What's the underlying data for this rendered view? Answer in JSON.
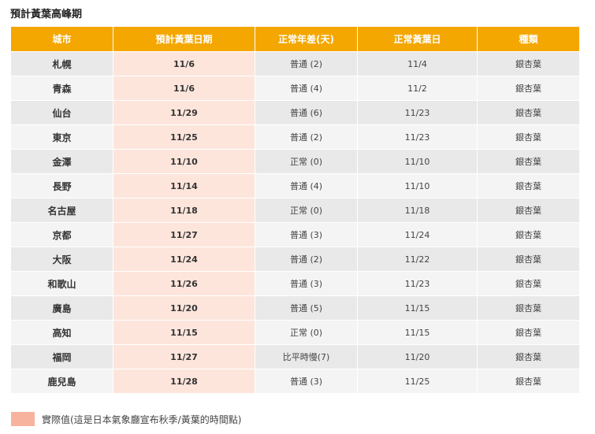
{
  "title": "預計黃葉高峰期",
  "headers": [
    "城市",
    "預計黃葉日期",
    "正常年差(天)",
    "正常黃葉日",
    "種類"
  ],
  "rows": [
    {
      "city": "札幌",
      "predicted": "11/6",
      "diff": "普通 (2)",
      "normal": "11/4",
      "kind": "銀杏葉"
    },
    {
      "city": "青森",
      "predicted": "11/6",
      "diff": "普通 (4)",
      "normal": "11/2",
      "kind": "銀杏葉"
    },
    {
      "city": "仙台",
      "predicted": "11/29",
      "diff": "普通 (6)",
      "normal": "11/23",
      "kind": "銀杏葉"
    },
    {
      "city": "東京",
      "predicted": "11/25",
      "diff": "普通 (2)",
      "normal": "11/23",
      "kind": "銀杏葉"
    },
    {
      "city": "金澤",
      "predicted": "11/10",
      "diff": "正常 (0)",
      "normal": "11/10",
      "kind": "銀杏葉"
    },
    {
      "city": "長野",
      "predicted": "11/14",
      "diff": "普通 (4)",
      "normal": "11/10",
      "kind": "銀杏葉"
    },
    {
      "city": "名古屋",
      "predicted": "11/18",
      "diff": "正常 (0)",
      "normal": "11/18",
      "kind": "銀杏葉"
    },
    {
      "city": "京都",
      "predicted": "11/27",
      "diff": "普通 (3)",
      "normal": "11/24",
      "kind": "銀杏葉"
    },
    {
      "city": "大阪",
      "predicted": "11/24",
      "diff": "普通 (2)",
      "normal": "11/22",
      "kind": "銀杏葉"
    },
    {
      "city": "和歌山",
      "predicted": "11/26",
      "diff": "普通 (3)",
      "normal": "11/23",
      "kind": "銀杏葉"
    },
    {
      "city": "廣島",
      "predicted": "11/20",
      "diff": "普通 (5)",
      "normal": "11/15",
      "kind": "銀杏葉"
    },
    {
      "city": "高知",
      "predicted": "11/15",
      "diff": "正常 (0)",
      "normal": "11/15",
      "kind": "銀杏葉"
    },
    {
      "city": "福岡",
      "predicted": "11/27",
      "diff": "比平時慢(7)",
      "normal": "11/20",
      "kind": "銀杏葉"
    },
    {
      "city": "鹿兒島",
      "predicted": "11/28",
      "diff": "普通 (3)",
      "normal": "11/25",
      "kind": "銀杏葉"
    }
  ],
  "legend": {
    "text": "實際值(這是日本氣象廳宣布秋季/黃葉的時間點)",
    "color": "#f7b39e"
  },
  "colors": {
    "header": "#f4a700",
    "predicted_cell": "#fde5dc"
  }
}
